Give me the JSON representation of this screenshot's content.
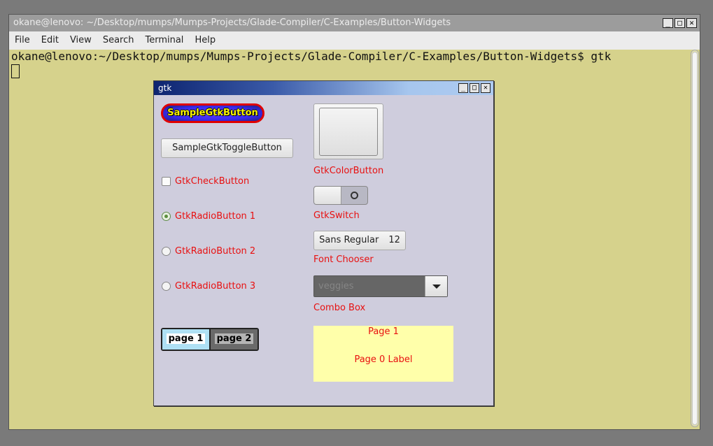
{
  "terminal": {
    "title": "okane@lenovo: ~/Desktop/mumps/Mumps-Projects/Glade-Compiler/C-Examples/Button-Widgets",
    "window_buttons": [
      "_",
      "□",
      "✕"
    ],
    "menu": [
      "File",
      "Edit",
      "View",
      "Search",
      "Terminal",
      "Help"
    ],
    "prompt_line": "okane@lenovo:~/Desktop/mumps/Mumps-Projects/Glade-Compiler/C-Examples/Button-Widgets$ gtk"
  },
  "gtk": {
    "title": "gtk",
    "window_buttons": [
      "_",
      "□",
      "✕"
    ],
    "sample_button": "SampleGtkButton",
    "toggle_button": "SampleGtkToggleButton",
    "check_button": "GtkCheckButton",
    "radios": [
      "GtkRadioButton 1",
      "GtkRadioButton 2",
      "GtkRadioButton 3"
    ],
    "radio_selected": "GtkRadioButton 1",
    "tabs": [
      "page 1",
      "page 2"
    ],
    "color_button_label": "GtkColorButton",
    "switch_label": "GtkSwitch",
    "font_button": {
      "family": "Sans Regular",
      "size": "12"
    },
    "font_label": "Font Chooser",
    "combo": {
      "placeholder": "veggies"
    },
    "combo_label": "Combo Box",
    "notebook_page": {
      "title": "Page 1",
      "label": "Page 0 Label"
    }
  },
  "colors": {
    "terminal_bg": "#d6d28c",
    "dialog_bg": "#cfcddd",
    "label_red": "#e81010",
    "notebook_bg": "#ffffaa"
  }
}
